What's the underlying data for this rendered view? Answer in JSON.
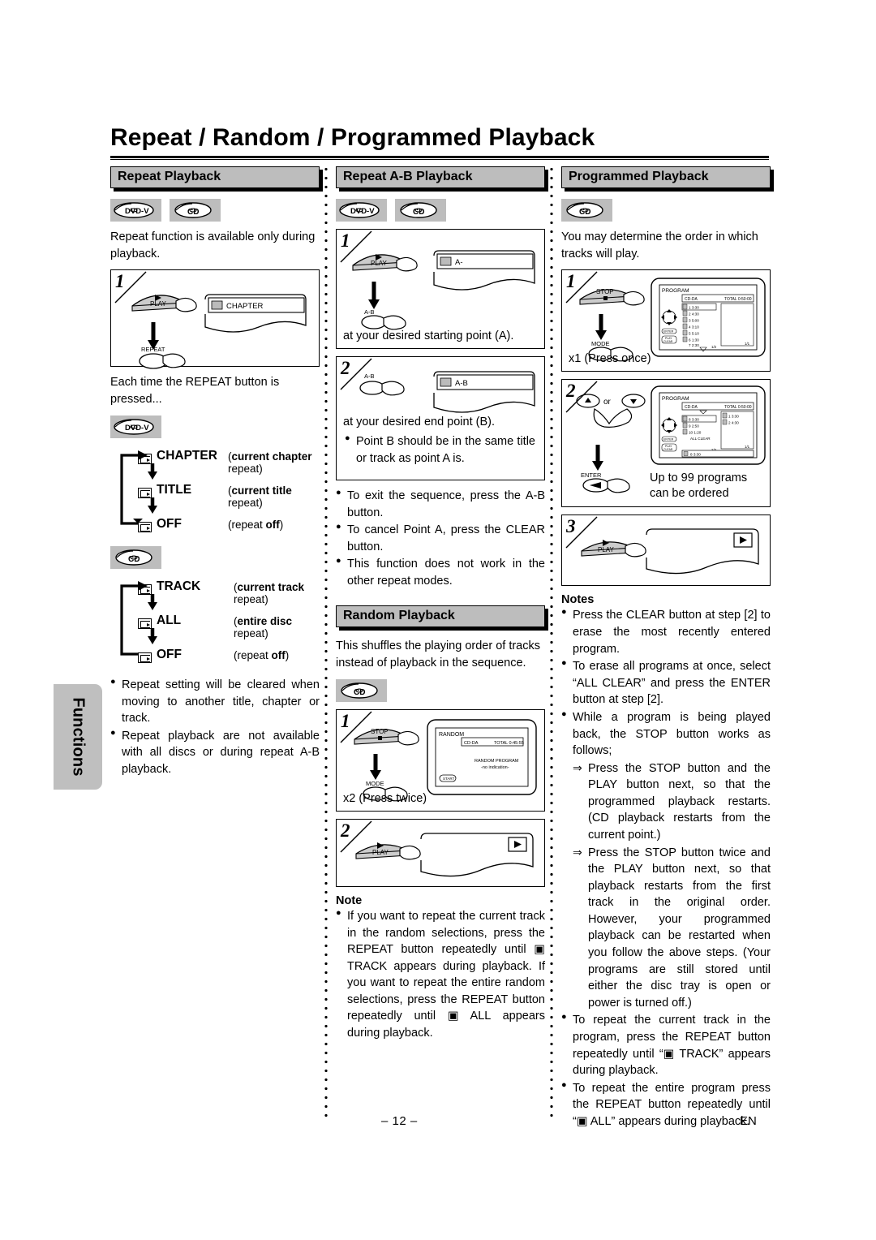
{
  "page": {
    "title": "Repeat / Random / Programmed Playback",
    "side_tab": "Functions",
    "footer_page": "– 12 –",
    "footer_lang": "EN"
  },
  "columns": {
    "repeat": {
      "heading": "Repeat Playback",
      "badges": [
        "dvd-v-badge",
        "cd-badge"
      ],
      "intro": "Repeat function is available only during playback.",
      "step1": {
        "number": "1",
        "button_top": "PLAY",
        "button_bottom": "REPEAT",
        "osd": "CHAPTER"
      },
      "after_step": "Each time the REPEAT button is pressed...",
      "dvd_modes": {
        "badge": "dvd-v-badge",
        "items": [
          {
            "name": "CHAPTER",
            "desc_bold": "current chapter",
            "desc_rest": " repeat"
          },
          {
            "name": "TITLE",
            "desc_bold": "current title",
            "desc_rest": " repeat"
          },
          {
            "name": "OFF",
            "desc_pre": "repeat ",
            "desc_bold": "off"
          }
        ]
      },
      "cd_modes": {
        "badge": "cd-badge",
        "items": [
          {
            "name": "TRACK",
            "desc_bold": "current track",
            "desc_rest": " repeat"
          },
          {
            "name": "ALL",
            "desc_bold": "entire disc",
            "desc_rest": " repeat"
          },
          {
            "name": "OFF",
            "desc_pre": "repeat ",
            "desc_bold": "off"
          }
        ]
      },
      "notes": [
        "Repeat setting will be cleared when moving to another title, chapter or track.",
        "Repeat playback are not available with all discs or during repeat A-B playback."
      ]
    },
    "repeat_ab": {
      "heading": "Repeat A-B Playback",
      "badges": [
        "dvd-v-badge",
        "cd-badge"
      ],
      "step1": {
        "number": "1",
        "button_top": "PLAY",
        "button_bottom": "A-B",
        "osd": "A-",
        "caption": "at your desired starting point (A)."
      },
      "step2": {
        "number": "2",
        "button": "A-B",
        "osd": "A-B",
        "caption": "at your desired end point (B).",
        "bullet": "Point B should be in the same title or track as point A is."
      },
      "notes": [
        "To exit the sequence, press the A-B button.",
        "To cancel Point A, press the CLEAR button.",
        "This function does not work in the other repeat modes."
      ]
    },
    "random": {
      "heading": "Random Playback",
      "intro": "This shuffles the playing order of tracks instead of playback in the sequence.",
      "badges": [
        "cd-badge"
      ],
      "step1": {
        "number": "1",
        "button_top": "STOP",
        "button_bottom": "MODE",
        "caption": "x2 (Press twice)",
        "osd": {
          "title": "RANDOM",
          "disc": "CD-DA",
          "total": "TOTAL 0:45:55",
          "line1": "RANDOM PROGRAM",
          "line2": "-no indication-",
          "button": "START"
        }
      },
      "step2": {
        "number": "2",
        "button": "PLAY",
        "osd_icon": "play-icon"
      },
      "note_title": "Note",
      "notes": [
        "If you want to repeat the current track in the random selections, press the REPEAT button repeatedly until ▣ TRACK appears during playback. If you want to repeat the entire random selections, press the REPEAT button repeatedly until ▣ ALL appears during playback."
      ]
    },
    "programmed": {
      "heading": "Programmed Playback",
      "badges": [
        "cd-badge"
      ],
      "intro": "You may determine the order in which tracks will play.",
      "step1": {
        "number": "1",
        "button_top": "STOP",
        "button_bottom": "MODE",
        "caption": "x1 (Press once)",
        "osd": {
          "title": "PROGRAM",
          "disc": "CD-DA",
          "total": "TOTAL 0:50:00",
          "tracks": [
            "1  3:30",
            "2  4:30",
            "3  5:00",
            "4  3:10",
            "5  5:10",
            "6  1:30",
            "7  2:30"
          ],
          "page": "1/2",
          "page_right": "1/1",
          "selected": "1  3:30",
          "btn_enter": "ENTER",
          "btn_play": "PLAY",
          "btn_clear": "CLEAR"
        }
      },
      "step2": {
        "number": "2",
        "key_up": "▲",
        "key_or": "or",
        "key_down": "▼",
        "button": "ENTER",
        "caption": "Up to 99 programs can be ordered",
        "osd": {
          "title": "PROGRAM",
          "disc": "CD-DA",
          "total": "TOTAL 0:50:00",
          "tracks": [
            "8  3:30",
            "9  2:50",
            "10 1:20"
          ],
          "all_clear": "ALL CLEAR",
          "page": "2/2",
          "page_right": "1/1",
          "selected": "8  3:30",
          "ordered": [
            "1  3:30",
            "2  4:30"
          ]
        }
      },
      "step3": {
        "number": "3",
        "button": "PLAY",
        "osd_icon": "play-icon"
      },
      "note_title": "Notes",
      "notes": [
        "Press the CLEAR button at step [2] to erase the most recently entered program.",
        "To erase all programs at once, select “ALL CLEAR” and press the ENTER button at step [2].",
        "While a program is being played back, the STOP button works as follows;"
      ],
      "sub_notes": [
        "Press the STOP button and the PLAY button next, so that the programmed playback restarts. (CD playback restarts from the current point.)",
        "Press the STOP button twice and the PLAY button next, so that playback restarts from the first track in the original order. However, your programmed playback can be restarted when you follow the above steps. (Your programs are still stored until either the disc tray is open or power is turned off.)"
      ],
      "notes_tail": [
        "To repeat the current track in the program, press the REPEAT button repeatedly until “▣ TRACK” appears during playback.",
        "To repeat the entire program press the REPEAT button repeatedly until “▣ ALL” appears during playback."
      ]
    }
  }
}
